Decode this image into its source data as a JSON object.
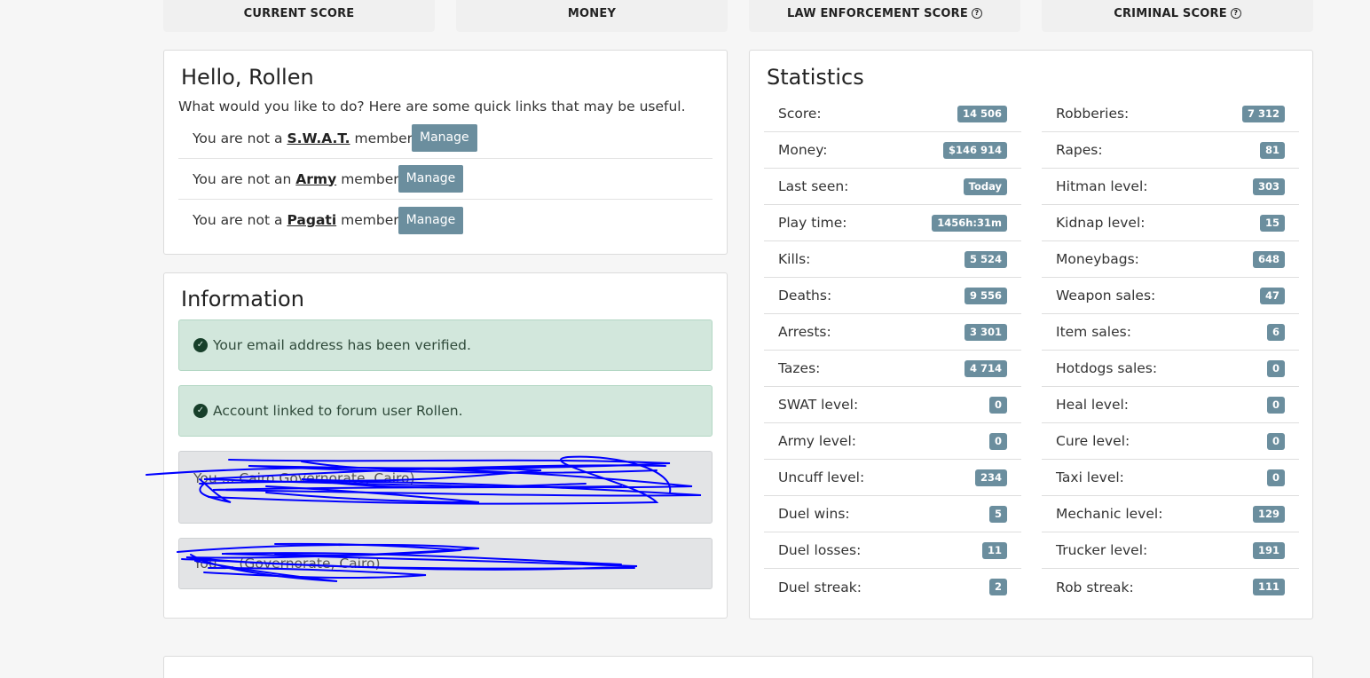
{
  "score_cards": [
    {
      "label": "CURRENT SCORE",
      "help": false
    },
    {
      "label": "MONEY",
      "help": false
    },
    {
      "label": "LAW ENFORCEMENT SCORE",
      "help": true
    },
    {
      "label": "CRIMINAL SCORE",
      "help": true
    }
  ],
  "hello": {
    "title": "Hello, Rollen",
    "intro": "What would you like to do? Here are some quick links that may be useful.",
    "memberships": [
      {
        "prefix": "You are not a",
        "group": "S.W.A.T.",
        "suffix": "member",
        "button": "Manage"
      },
      {
        "prefix": "You are not an",
        "group": "Army",
        "suffix": "member",
        "button": "Manage"
      },
      {
        "prefix": "You are not a",
        "group": "Pagati",
        "suffix": "member",
        "button": "Manage"
      }
    ]
  },
  "information": {
    "title": "Information",
    "alerts": [
      {
        "text": "Your email address has been verified.",
        "type": "success"
      },
      {
        "text": "Account linked to forum user Rollen.",
        "type": "success"
      },
      {
        "text": "You ... Cairo Governorate, Cairo)",
        "type": "muted"
      },
      {
        "text": "You ... (Governorate, Cairo)",
        "type": "muted"
      }
    ]
  },
  "statistics": {
    "title": "Statistics",
    "left": [
      {
        "label": "Score:",
        "value": "14 506"
      },
      {
        "label": "Money:",
        "value": "$146 914"
      },
      {
        "label": "Last seen:",
        "value": "Today"
      },
      {
        "label": "Play time:",
        "value": "1456h:31m"
      },
      {
        "label": "Kills:",
        "value": "5 524"
      },
      {
        "label": "Deaths:",
        "value": "9 556"
      },
      {
        "label": "Arrests:",
        "value": "3 301"
      },
      {
        "label": "Tazes:",
        "value": "4 714"
      },
      {
        "label": "SWAT level:",
        "value": "0"
      },
      {
        "label": "Army level:",
        "value": "0"
      },
      {
        "label": "Uncuff level:",
        "value": "234"
      },
      {
        "label": "Duel wins:",
        "value": "5"
      },
      {
        "label": "Duel losses:",
        "value": "11"
      },
      {
        "label": "Duel streak:",
        "value": "2"
      }
    ],
    "right": [
      {
        "label": "Robberies:",
        "value": "7 312"
      },
      {
        "label": "Rapes:",
        "value": "81"
      },
      {
        "label": "Hitman level:",
        "value": "303"
      },
      {
        "label": "Kidnap level:",
        "value": "15"
      },
      {
        "label": "Moneybags:",
        "value": "648"
      },
      {
        "label": "Weapon sales:",
        "value": "47"
      },
      {
        "label": "Item sales:",
        "value": "6"
      },
      {
        "label": "Hotdogs sales:",
        "value": "0"
      },
      {
        "label": "Heal level:",
        "value": "0"
      },
      {
        "label": "Cure level:",
        "value": "0"
      },
      {
        "label": "Taxi level:",
        "value": "0"
      },
      {
        "label": "Mechanic level:",
        "value": "129"
      },
      {
        "label": "Trucker level:",
        "value": "191"
      },
      {
        "label": "Rob streak:",
        "value": "111"
      }
    ]
  },
  "colors": {
    "badge": "#6b8e9e",
    "success_bg": "#d2e7dc",
    "scribble": "#0000ff"
  }
}
